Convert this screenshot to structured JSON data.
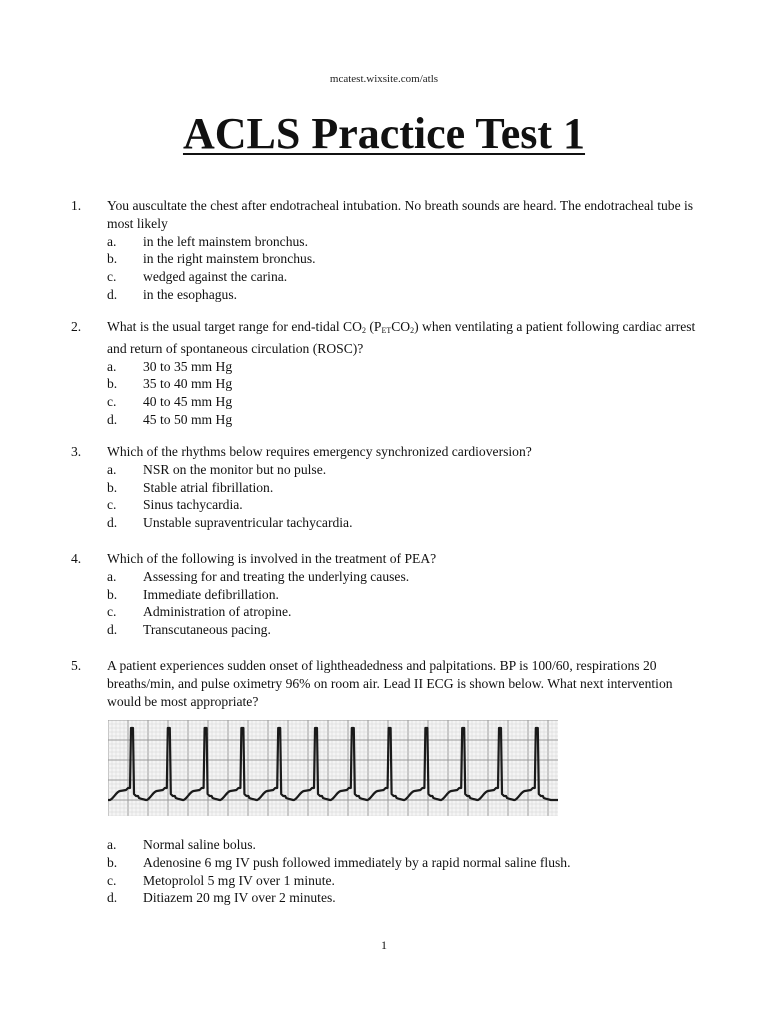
{
  "header": {
    "url": "mcatest.wixsite.com/atls"
  },
  "title": "ACLS Practice Test 1",
  "questions": [
    {
      "number": "1.",
      "text": "You auscultate the chest after endotracheal intubation.  No breath sounds are heard.  The endotracheal tube is most likely",
      "options": [
        {
          "letter": "a.",
          "text": "in the left mainstem bronchus."
        },
        {
          "letter": "b.",
          "text": "in the right mainstem bronchus."
        },
        {
          "letter": "c.",
          "text": "wedged against the carina."
        },
        {
          "letter": "d.",
          "text": "in the esophagus."
        }
      ]
    },
    {
      "number": "2.",
      "text_part1": "What is the usual target range for end-tidal CO",
      "sub1": "2",
      "text_part2": " (P",
      "sub2": "ET",
      "text_part3": "CO",
      "sub3": "2",
      "text_part4": ") when ventilating a patient following cardiac arrest and return of spontaneous circulation (ROSC)?",
      "options": [
        {
          "letter": "a.",
          "text": "30 to 35 mm Hg"
        },
        {
          "letter": "b.",
          "text": "35 to 40 mm Hg"
        },
        {
          "letter": "c.",
          "text": "40 to 45 mm Hg"
        },
        {
          "letter": "d.",
          "text": "45 to 50 mm Hg"
        }
      ]
    },
    {
      "number": "3.",
      "text": "Which of the rhythms below requires emergency synchronized cardioversion?",
      "options": [
        {
          "letter": "a.",
          "text": "NSR on the monitor but no pulse."
        },
        {
          "letter": "b.",
          "text": "Stable atrial fibrillation."
        },
        {
          "letter": "c.",
          "text": "Sinus tachycardia."
        },
        {
          "letter": "d.",
          "text": "Unstable supraventricular tachycardia."
        }
      ]
    },
    {
      "number": "4.",
      "text": "Which of the following is involved in the treatment of PEA?",
      "options": [
        {
          "letter": "a.",
          "text": "Assessing for and treating the underlying causes."
        },
        {
          "letter": "b.",
          "text": "Immediate defibrillation."
        },
        {
          "letter": "c.",
          "text": "Administration of atropine."
        },
        {
          "letter": "d.",
          "text": "Transcutaneous pacing."
        }
      ]
    },
    {
      "number": "5.",
      "text": "A patient experiences sudden onset of lightheadedness and palpitations.  BP is 100/60, respirations 20 breaths/min, and pulse oximetry 96% on room air.  Lead II ECG is shown below.  What next intervention would be most appropriate?",
      "ecg": {
        "label": "Lead II ECG strip",
        "beats": 12
      },
      "options": [
        {
          "letter": "a.",
          "text": "Normal saline bolus."
        },
        {
          "letter": "b.",
          "text": "Adenosine 6 mg IV push followed immediately by a rapid normal saline flush."
        },
        {
          "letter": "c.",
          "text": "Metoprolol 5 mg IV over 1 minute."
        },
        {
          "letter": "d.",
          "text": "Ditiazem 20 mg IV over 2 minutes."
        }
      ]
    }
  ],
  "page_number": "1"
}
